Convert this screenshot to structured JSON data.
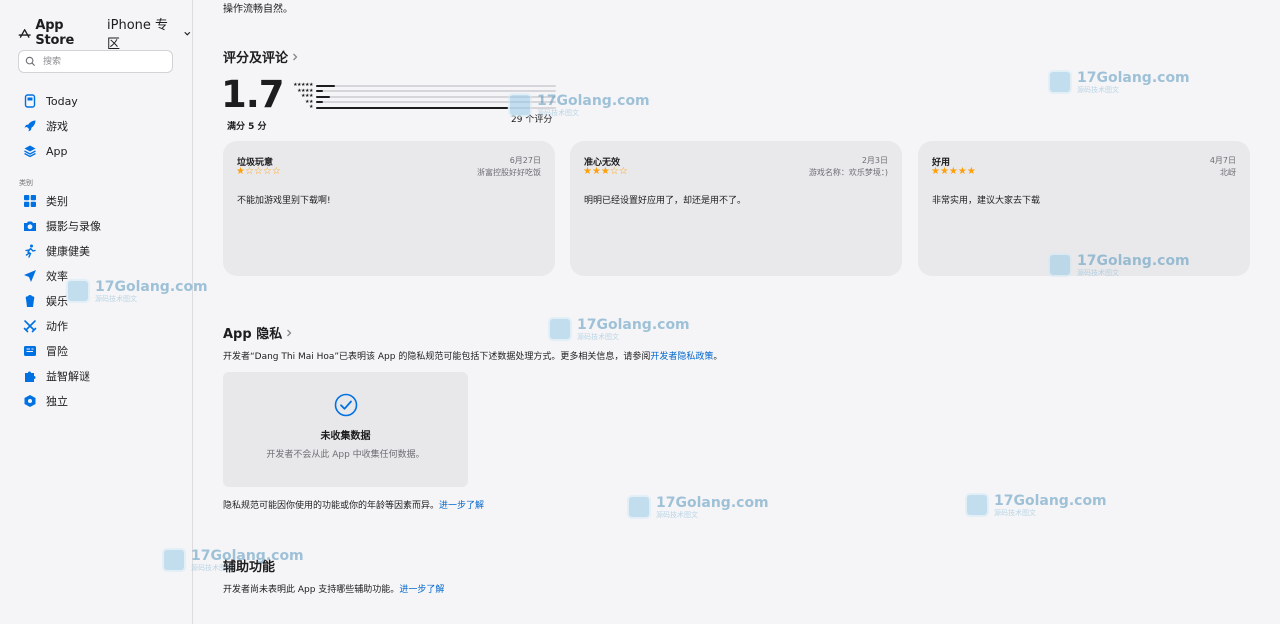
{
  "sidebar": {
    "brand_store": "App Store",
    "brand_zone": "iPhone 专区",
    "search_placeholder": "搜索",
    "nav": [
      {
        "label": "Today",
        "icon": "today-icon"
      },
      {
        "label": "游戏",
        "icon": "rocket-icon"
      },
      {
        "label": "App",
        "icon": "app-stack-icon"
      }
    ],
    "category_label": "类别",
    "categories": [
      {
        "label": "类别",
        "icon": "grid-icon"
      },
      {
        "label": "摄影与录像",
        "icon": "camera-icon"
      },
      {
        "label": "健康健美",
        "icon": "running-icon"
      },
      {
        "label": "效率",
        "icon": "paper-plane-icon"
      },
      {
        "label": "娱乐",
        "icon": "popcorn-icon"
      },
      {
        "label": "动作",
        "icon": "swords-icon"
      },
      {
        "label": "冒险",
        "icon": "map-icon"
      },
      {
        "label": "益智解谜",
        "icon": "puzzle-icon"
      },
      {
        "label": "独立",
        "icon": "indie-icon"
      }
    ]
  },
  "main": {
    "top_text": "操作流畅自然。",
    "ratings": {
      "title": "评分及评论",
      "score": "1.7",
      "out_of": "满分 5 分",
      "count_label": "29 个评分",
      "distribution": [
        {
          "stars": "★★★★★",
          "fraction": 0.08
        },
        {
          "stars": "★★★★",
          "fraction": 0.03
        },
        {
          "stars": "★★★",
          "fraction": 0.06
        },
        {
          "stars": "★★",
          "fraction": 0.03
        },
        {
          "stars": "★",
          "fraction": 0.8
        }
      ]
    },
    "reviews": [
      {
        "title": "垃圾玩意",
        "date": "6月27日",
        "author": "浙富控股好好吃饭",
        "stars": "★☆☆☆☆",
        "body": "不能加游戏里别下载啊!"
      },
      {
        "title": "准心无效",
        "date": "2月3日",
        "author": "游戏名称：欢乐梦境：)",
        "stars": "★★★☆☆",
        "body": "明明已经设置好应用了，却还是用不了。"
      },
      {
        "title": "好用",
        "date": "4月7日",
        "author": "北岈",
        "stars": "★★★★★",
        "body": "非常实用，建议大家去下载"
      }
    ],
    "privacy": {
      "title": "App 隐私",
      "desc_prefix": "开发者“Dang Thi Mai Hoa”已表明该 App 的隐私规范可能包括下述数据处理方式。更多相关信息，请参阅",
      "desc_link": "开发者隐私政策",
      "desc_suffix": "。",
      "card_title": "未收集数据",
      "card_subtitle": "开发者不会从此 App 中收集任何数据。",
      "note": "隐私规范可能因你使用的功能或你的年龄等因素而异。",
      "note_link": "进一步了解"
    },
    "accessibility": {
      "title": "辅助功能",
      "desc": "开发者尚未表明此 App 支持哪些辅助功能。",
      "link": "进一步了解"
    }
  },
  "watermark": {
    "main": "17Golang.com",
    "sub": "源码技术图文"
  }
}
